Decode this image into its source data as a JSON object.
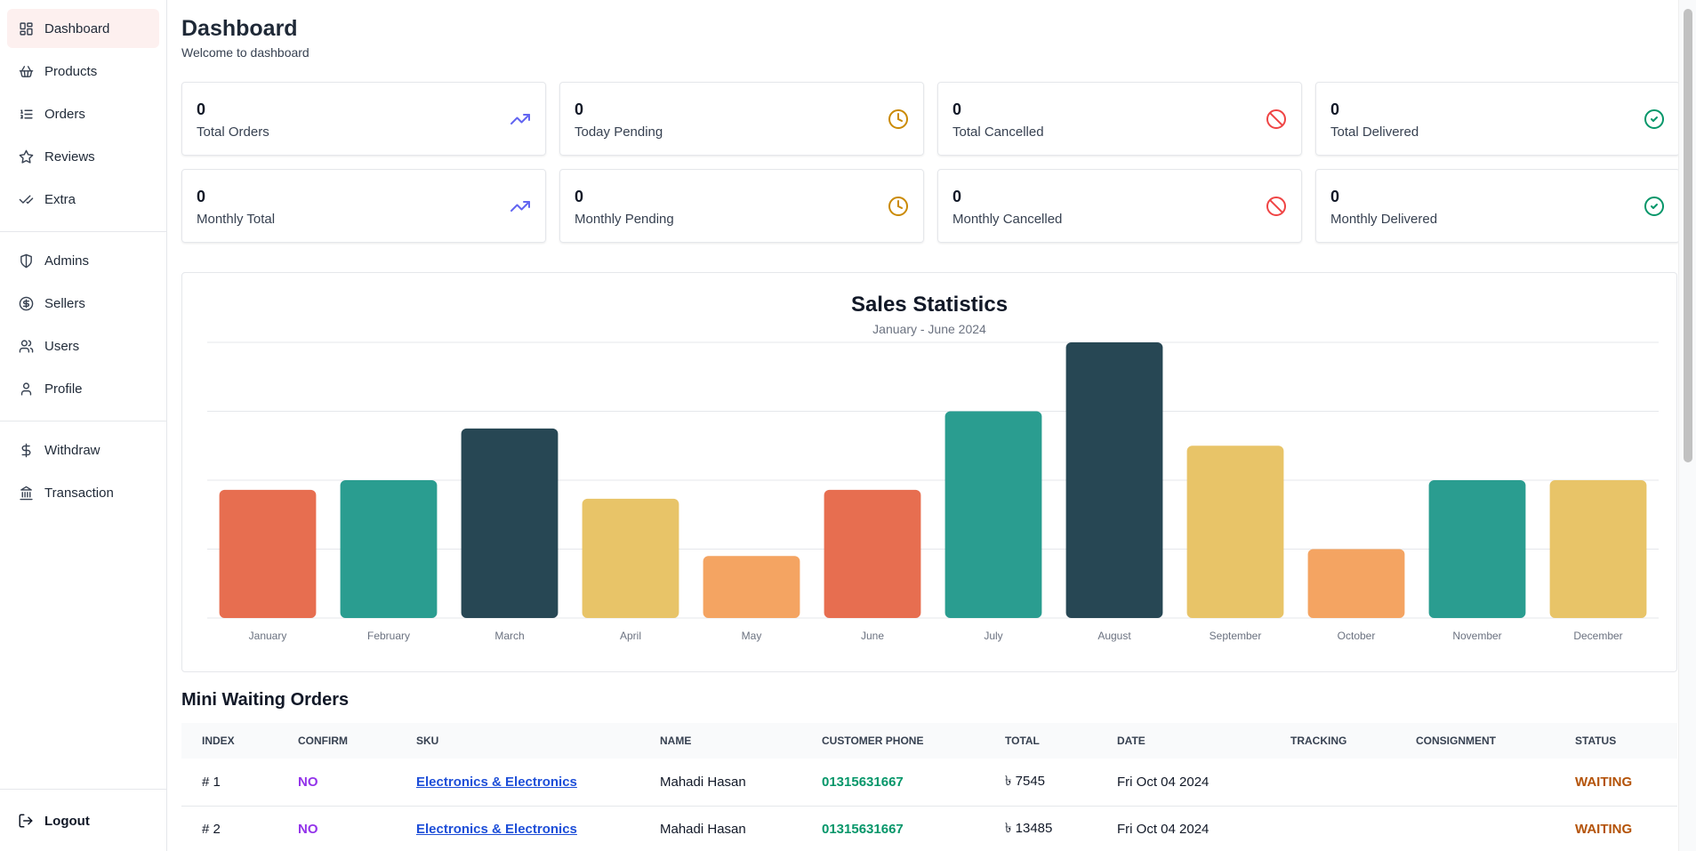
{
  "sidebar": {
    "groups": [
      [
        {
          "label": "Dashboard",
          "icon": "dashboard-icon"
        },
        {
          "label": "Products",
          "icon": "basket-icon"
        },
        {
          "label": "Orders",
          "icon": "list-icon"
        },
        {
          "label": "Reviews",
          "icon": "star-icon"
        },
        {
          "label": "Extra",
          "icon": "check-check-icon"
        }
      ],
      [
        {
          "label": "Admins",
          "icon": "shield-icon"
        },
        {
          "label": "Sellers",
          "icon": "dollar-circle-icon"
        },
        {
          "label": "Users",
          "icon": "users-icon"
        },
        {
          "label": "Profile",
          "icon": "user-icon"
        }
      ],
      [
        {
          "label": "Withdraw",
          "icon": "dollar-icon"
        },
        {
          "label": "Transaction",
          "icon": "bank-icon"
        }
      ]
    ],
    "logout_label": "Logout"
  },
  "header": {
    "title": "Dashboard",
    "subtitle": "Welcome to dashboard"
  },
  "stats": [
    {
      "value": "0",
      "label": "Total Orders",
      "icon": "trending-up-icon",
      "color": "#6366f1"
    },
    {
      "value": "0",
      "label": "Today Pending",
      "icon": "clock-icon",
      "color": "#ca8a04"
    },
    {
      "value": "0",
      "label": "Total Cancelled",
      "icon": "ban-icon",
      "color": "#ef4444"
    },
    {
      "value": "0",
      "label": "Total Delivered",
      "icon": "check-circle-icon",
      "color": "#059669"
    },
    {
      "value": "0",
      "label": "Monthly Total",
      "icon": "trending-up-icon",
      "color": "#6366f1"
    },
    {
      "value": "0",
      "label": "Monthly Pending",
      "icon": "clock-icon",
      "color": "#ca8a04"
    },
    {
      "value": "0",
      "label": "Monthly Cancelled",
      "icon": "ban-icon",
      "color": "#ef4444"
    },
    {
      "value": "0",
      "label": "Monthly Delivered",
      "icon": "check-circle-icon",
      "color": "#059669"
    }
  ],
  "chart_data": {
    "type": "bar",
    "title": "Sales Statistics",
    "subtitle": "January - June 2024",
    "categories": [
      "January",
      "February",
      "March",
      "April",
      "May",
      "June",
      "July",
      "August",
      "September",
      "October",
      "November",
      "December"
    ],
    "values": [
      186,
      200,
      275,
      173,
      90,
      186,
      300,
      400,
      250,
      100,
      200,
      200
    ],
    "colors": [
      "#e76e50",
      "#2a9d90",
      "#274754",
      "#e8c468",
      "#f4a462",
      "#e76e50",
      "#2a9d90",
      "#274754",
      "#e8c468",
      "#f4a462",
      "#2a9d90",
      "#e8c468"
    ],
    "ylim": [
      0,
      400
    ],
    "grid": true,
    "xlabel": "",
    "ylabel": ""
  },
  "orders": {
    "title": "Mini Waiting Orders",
    "columns": [
      "INDEX",
      "CONFIRM",
      "SKU",
      "NAME",
      "CUSTOMER PHONE",
      "TOTAL",
      "DATE",
      "TRACKING",
      "CONSIGNMENT",
      "STATUS"
    ],
    "rows": [
      {
        "index": "# 1",
        "confirm": "NO",
        "sku": "Electronics & Electronics",
        "name": "Mahadi Hasan",
        "phone": "01315631667",
        "total": "৳ 7545",
        "date": "Fri Oct 04 2024",
        "tracking": "",
        "consignment": "",
        "status": "WAITING"
      },
      {
        "index": "# 2",
        "confirm": "NO",
        "sku": "Electronics & Electronics",
        "name": "Mahadi Hasan",
        "phone": "01315631667",
        "total": "৳ 13485",
        "date": "Fri Oct 04 2024",
        "tracking": "",
        "consignment": "",
        "status": "WAITING"
      }
    ]
  }
}
